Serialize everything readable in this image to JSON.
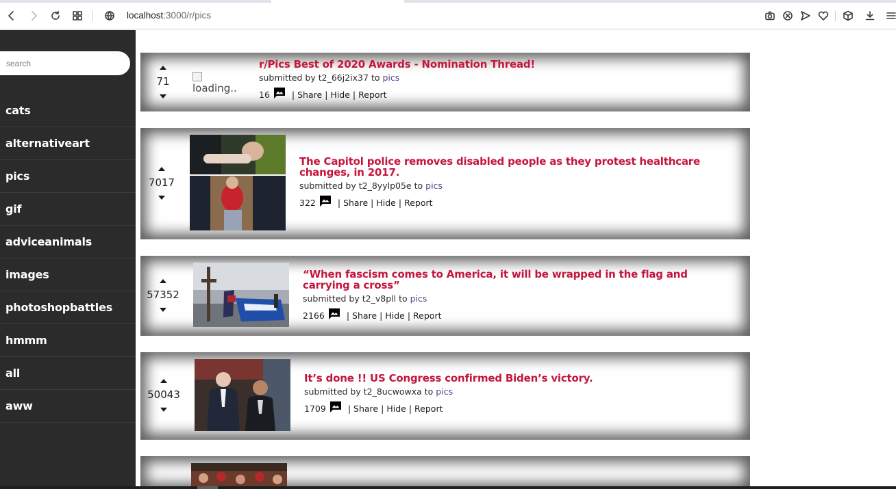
{
  "browser": {
    "url_host": "localhost",
    "url_path": ":3000/r/pics"
  },
  "sidebar": {
    "search_placeholder": "search",
    "items": [
      {
        "label": "cats"
      },
      {
        "label": "alternativeart"
      },
      {
        "label": "pics"
      },
      {
        "label": "gif"
      },
      {
        "label": "adviceanimals"
      },
      {
        "label": "images"
      },
      {
        "label": "photoshopbattles"
      },
      {
        "label": "hmmm"
      },
      {
        "label": "all"
      },
      {
        "label": "aww"
      }
    ]
  },
  "feed": {
    "submitted_by_label": "submitted by",
    "to_label": "to",
    "share_label": "Share",
    "hide_label": "Hide",
    "report_label": "Report",
    "separator": "|",
    "posts": [
      {
        "score": "71",
        "title": "r/Pics Best of 2020 Awards - Nomination Thread!",
        "author": "t2_66j2ix37",
        "subreddit": "pics",
        "comments": "16",
        "thumb_alt": "loading.."
      },
      {
        "score": "7017",
        "title": "The Capitol police removes disabled people as they protest healthcare changes, in 2017.",
        "author": "t2_8yylp05e",
        "subreddit": "pics",
        "comments": "322"
      },
      {
        "score": "57352",
        "title": "“When fascism comes to America, it will be wrapped in the flag and carrying a cross”",
        "author": "t2_v8pll",
        "subreddit": "pics",
        "comments": "2166"
      },
      {
        "score": "50043",
        "title": "It’s done !! US Congress confirmed Biden’s victory.",
        "author": "t2_8ucwowxa",
        "subreddit": "pics",
        "comments": "1709"
      }
    ]
  },
  "colors": {
    "title": "#c4163c",
    "subreddit_link": "#5a3e8a",
    "sidebar_bg": "#2b2b2b"
  }
}
